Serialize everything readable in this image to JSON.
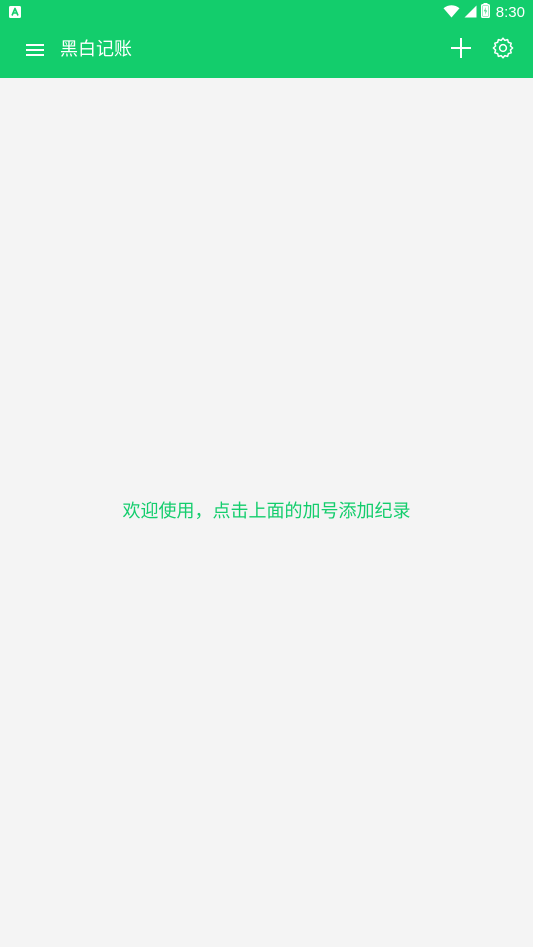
{
  "colors": {
    "primary": "#13cd6c",
    "background": "#f4f4f4",
    "on_primary": "#ffffff"
  },
  "status_bar": {
    "time": "8:30",
    "icons": [
      "notification-a-icon",
      "wifi-icon",
      "cell-signal-icon",
      "battery-icon"
    ]
  },
  "app_bar": {
    "title": "黑白记账",
    "icons": [
      "menu-icon",
      "add-icon",
      "settings-icon"
    ]
  },
  "main": {
    "empty_message": "欢迎使用，点击上面的加号添加纪录"
  }
}
